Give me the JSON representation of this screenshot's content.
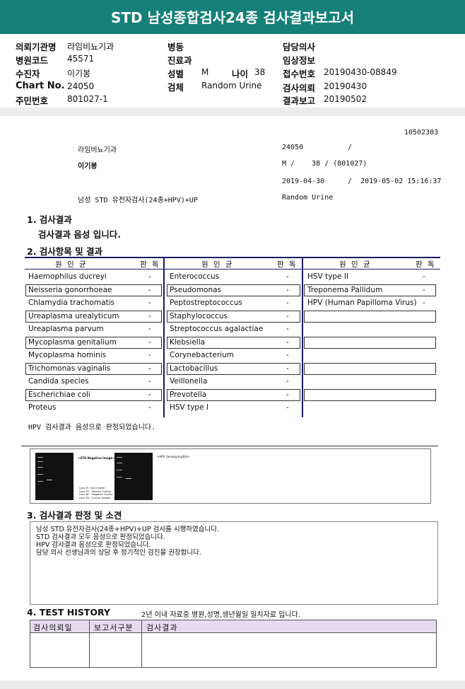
{
  "report": {
    "title": "STD 남성종합검사24종 검사결과보고서"
  },
  "header": {
    "left": [
      {
        "label": "의뢰기관명",
        "value": "라임비뇨기과"
      },
      {
        "label": "병원코드",
        "value": "45571"
      },
      {
        "label": "수진자",
        "value": "이기봉"
      },
      {
        "label": "Chart No.",
        "value": "24050"
      },
      {
        "label": "주민번호",
        "value": "801027-1"
      }
    ],
    "mid": {
      "ward_label": "병동",
      "dept_label": "진료과",
      "sex_label": "성별",
      "sex_value": "M",
      "age_label": "나이",
      "age_value": "38",
      "specimen_label": "검체",
      "specimen_value": "Random Urine"
    },
    "right": [
      {
        "label": "담당의사",
        "value": ""
      },
      {
        "label": "임상정보",
        "value": ""
      },
      {
        "label": "접수번호",
        "value": "20190430-08849"
      },
      {
        "label": "검사의뢰",
        "value": "20190430"
      },
      {
        "label": "결과보고",
        "value": "20190502"
      }
    ]
  },
  "print_block": {
    "code": "10502303",
    "clinic": "라임비뇨기과",
    "chart": "24050",
    "slash1": "/",
    "patient": "이기봉",
    "sex_age": "M /    38 / (801027)",
    "date_requested": "2019-04-30",
    "date_reported": "/  2019-05-02 15:16:37",
    "test_name": "남성 STD 유전자검사(24종+HPV)+UP",
    "specimen": "Random Urine"
  },
  "section1": {
    "heading": "1. 검사결과",
    "summary": "검사결과 음성 입니다."
  },
  "section2": {
    "heading": "2. 검사항목 및 결과",
    "col_header_pathogen": "원 인 균",
    "col_header_result": "판 독",
    "col1": [
      {
        "name": "Haemophilus ducreyi",
        "result": "-"
      },
      {
        "name": "Neisseria gonorrhoeae",
        "result": "-"
      },
      {
        "name": "Chlamydia trachomatis",
        "result": "-"
      },
      {
        "name": "Ureaplasma urealyticum",
        "result": "-"
      },
      {
        "name": "Ureaplasma parvum",
        "result": "-"
      },
      {
        "name": "Mycoplasma genitalium",
        "result": "-"
      },
      {
        "name": "Mycoplasma hominis",
        "result": "-"
      },
      {
        "name": "Trichomonas vaginalis",
        "result": "-"
      },
      {
        "name": "Candida species",
        "result": "-"
      },
      {
        "name": "Escherichiae coli",
        "result": "-"
      },
      {
        "name": "Proteus",
        "result": "-"
      }
    ],
    "col2": [
      {
        "name": "Enterococcus",
        "result": "-"
      },
      {
        "name": "Pseudomonas",
        "result": "-"
      },
      {
        "name": "Peptostreptococcus",
        "result": "-"
      },
      {
        "name": "Staphylococcus",
        "result": "-"
      },
      {
        "name": "Streptococcus agalactiae",
        "result": "-"
      },
      {
        "name": "Klebsiella",
        "result": "-"
      },
      {
        "name": "Corynebacterium",
        "result": "-"
      },
      {
        "name": "Lactobacillus",
        "result": "-"
      },
      {
        "name": "Veillonella",
        "result": "-"
      },
      {
        "name": "Prevotella",
        "result": "-"
      },
      {
        "name": "HSV type I",
        "result": "-"
      }
    ],
    "col3": [
      {
        "name": "HSV type II",
        "result": "-"
      },
      {
        "name": "Treponema Pallidum",
        "result": "-"
      },
      {
        "name": "HPV (Human Papilloma Virus)",
        "result": "-"
      }
    ],
    "hpv_note": "HPV 검사결과 음성으로 판정되었습니다."
  },
  "gel": {
    "title": "<STD Negative Image>",
    "hpv_title": "<HPV Genotyping결과>",
    "legend": [
      "Lane M : Size marker",
      "Lane PC : Positive Control",
      "Lane NC : Negative Control",
      "Lane SA : Clinical Sample"
    ]
  },
  "section3": {
    "heading": "3. 검사결과 판정 및 소견",
    "lines": [
      "남성 STD 유전자검사(24종+HPV)+UP 검사를 시행하였습니다.",
      "STD 검사결과 모두 음성으로 판정되었습니다.",
      "HPV 검사결과 음성으로 판정되었습니다.",
      "담당 의사 선생님과의 상담 후 정기적인 검진을 권장합니다."
    ]
  },
  "section4": {
    "heading": "4. TEST HISTORY",
    "note": "2년 이내 자료중 병원,성명,생년월일 일치자료 입니다.",
    "columns": [
      "검사의뢰일",
      "보고서구분",
      "검사결과"
    ]
  }
}
